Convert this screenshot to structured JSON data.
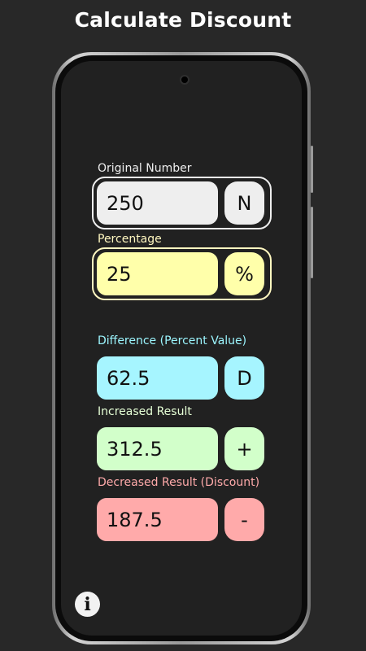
{
  "header": {
    "title": "Calculate Discount"
  },
  "fields": {
    "original": {
      "label": "Original Number",
      "value": "250",
      "symbol": "N",
      "label_color": "#eeeeee",
      "box_color": "#eeeeee"
    },
    "percentage": {
      "label": "Percentage",
      "value": "25",
      "symbol": "%",
      "label_color": "#fff7c0",
      "box_color": "#ffffaa"
    },
    "difference": {
      "label": "Difference (Percent Value)",
      "value": "62.5",
      "symbol": "D",
      "label_color": "#9cf6ff",
      "box_color": "#a6f5ff"
    },
    "increased": {
      "label": "Increased Result",
      "value": "312.5",
      "symbol": "+",
      "label_color": "#e6ffd6",
      "box_color": "#d2ffca"
    },
    "decreased": {
      "label": "Decreased Result (Discount)",
      "value": "187.5",
      "symbol": "-",
      "label_color": "#ffaaaa",
      "box_color": "#ffaaaa"
    }
  },
  "info": {
    "icon": "info-icon",
    "glyph": "i"
  }
}
